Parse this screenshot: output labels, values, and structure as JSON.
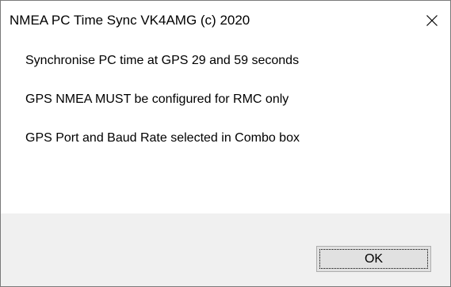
{
  "window": {
    "title": "NMEA PC Time Sync VK4AMG (c) 2020",
    "close_icon": "close-icon"
  },
  "messages": [
    "Synchronise PC time at GPS 29 and 59 seconds",
    "GPS NMEA MUST be configured for RMC only",
    "GPS Port and Baud Rate selected in Combo box"
  ],
  "buttons": {
    "ok_label": "OK"
  },
  "colors": {
    "background": "#ffffff",
    "footer": "#f0f0f0",
    "button_face": "#e1e1e1",
    "button_border": "#adadad"
  }
}
